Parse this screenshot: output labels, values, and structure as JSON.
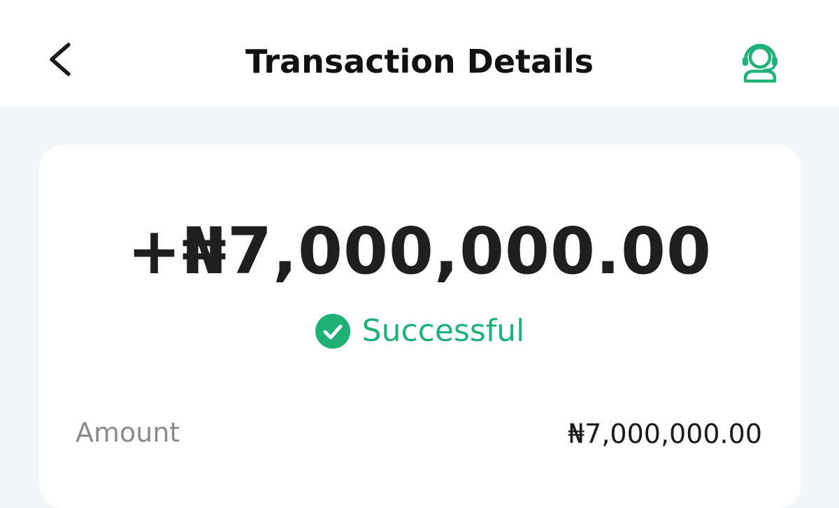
{
  "header": {
    "title": "Transaction Details",
    "back_icon": "chevron-left-icon",
    "support_icon": "customer-support-headset-icon"
  },
  "summary": {
    "amount": "+₦7,000,000.00",
    "status_label": "Successful",
    "status_icon": "check-circle-icon"
  },
  "details": [
    {
      "label": "Amount",
      "value": "₦7,000,000.00"
    }
  ],
  "colors": {
    "accent": "#1eb276",
    "background": "#f4f5f7",
    "card": "#ffffff",
    "label": "#8a8a8a",
    "text": "#1f1f1f"
  }
}
